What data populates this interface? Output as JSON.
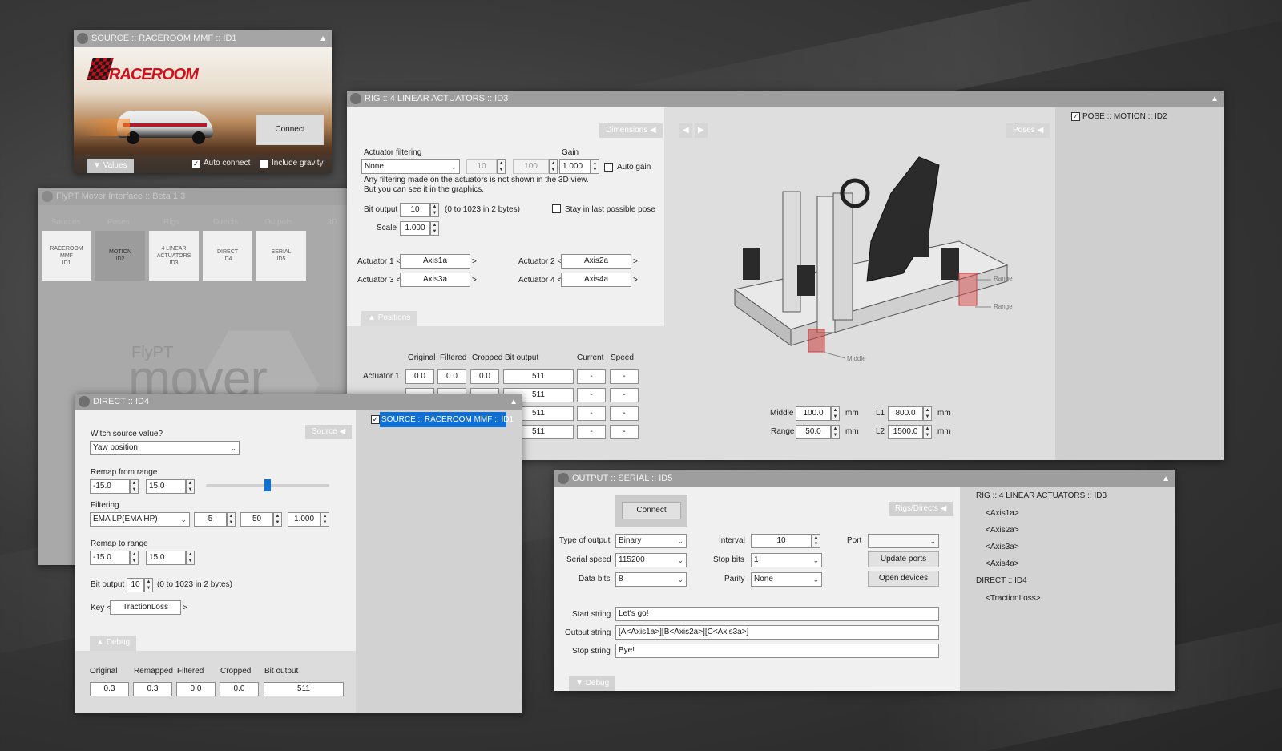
{
  "source_win": {
    "title": "SOURCE :: RACEROOM MMF :: ID1",
    "logo_text": "RACEROOM",
    "connect": "Connect",
    "values_tab": "Values",
    "auto_connect": "Auto connect",
    "include_gravity": "Include gravity"
  },
  "main_win": {
    "title": "FlyPT Mover Interface :: Beta 1.3",
    "headers": [
      "Sources",
      "Poses",
      "Rigs",
      "Directs",
      "Outputs",
      "3D"
    ],
    "tiles": [
      [
        "RACEROOM",
        "MMF",
        "ID1"
      ],
      [
        "MOTION",
        "ID2"
      ],
      [
        "4 LINEAR",
        "ACTUATORS",
        "ID3"
      ],
      [
        "DIRECT",
        "ID4"
      ],
      [
        "SERIAL",
        "ID5"
      ]
    ],
    "brand_small": "FlyPT",
    "brand_big": "mover"
  },
  "rig_win": {
    "title": "RIG :: 4 LINEAR ACTUATORS :: ID3",
    "dimensions_tab": "Dimensions",
    "poses_tab": "Poses",
    "actuator_filtering_label": "Actuator filtering",
    "filter_value": "None",
    "filter_p1": "10",
    "filter_p2": "100",
    "gain_label": "Gain",
    "gain": "1.000",
    "auto_gain": "Auto gain",
    "note1": "Any filtering made on the actuators is not shown in the 3D view.",
    "note2": "But you can see it in the graphics.",
    "bit_output_label": "Bit output",
    "bit_output": "10",
    "bit_range": "(0 to 1023 in 2 bytes)",
    "stay_last": "Stay in last possible pose",
    "scale_label": "Scale",
    "scale": "1.000",
    "act1_label": "Actuator 1 <",
    "act1": "Axis1a",
    "act2_label": "Actuator 2 <",
    "act2": "Axis2a",
    "act3_label": "Actuator 3 <",
    "act3": "Axis3a",
    "act4_label": "Actuator 4 <",
    "act4": "Axis4a",
    "gt": ">",
    "positions_tab": "Positions",
    "pos_headers": [
      "Original",
      "Filtered",
      "Cropped",
      "Bit output",
      "Current",
      "Speed"
    ],
    "pos_rows": [
      {
        "label": "Actuator 1",
        "original": "0.0",
        "filtered": "0.0",
        "cropped": "0.0",
        "bit": "511",
        "current": "-",
        "speed": "-"
      },
      {
        "label": "",
        "original": "",
        "filtered": "",
        "cropped": "",
        "bit": "511",
        "current": "-",
        "speed": "-"
      },
      {
        "label": "",
        "original": "",
        "filtered": "",
        "cropped": "",
        "bit": "511",
        "current": "-",
        "speed": "-"
      },
      {
        "label": "",
        "original": "",
        "filtered": "",
        "cropped": "",
        "bit": "511",
        "current": "-",
        "speed": "-"
      }
    ],
    "range_label1": "Range",
    "range_label2": "Range",
    "middle_callout": "Middle",
    "middle_label": "Middle",
    "middle": "100.0",
    "range_label": "Range",
    "range": "50.0",
    "l1_label": "L1",
    "l1": "800.0",
    "l2_label": "L2",
    "l2": "1500.0",
    "unit": "mm",
    "pose_checkbox": "POSE :: MOTION :: ID2"
  },
  "direct_win": {
    "title": "DIRECT :: ID4",
    "source_tab": "Source",
    "witch_label": "Witch source value?",
    "witch_value": "Yaw position",
    "remap_from_label": "Remap from range",
    "from_min": "-15.0",
    "from_max": "15.0",
    "slider_value": 0.5,
    "filtering_label": "Filtering",
    "filter_value": "EMA LP(EMA HP)",
    "f1": "5",
    "f2": "50",
    "f3": "1.000",
    "remap_to_label": "Remap to range",
    "to_min": "-15.0",
    "to_max": "15.0",
    "bit_output_label": "Bit output",
    "bit_output": "10",
    "bit_range": "(0 to 1023 in 2 bytes)",
    "key_label": "Key <",
    "key": "TractionLoss",
    "gt": ">",
    "debug_tab": "Debug",
    "debug_headers": [
      "Original",
      "Remapped",
      "Filtered",
      "Cropped",
      "Bit output"
    ],
    "debug_values": [
      "0.3",
      "0.3",
      "0.0",
      "0.0",
      "511"
    ],
    "source_selected": "SOURCE :: RACEROOM MMF :: ID1"
  },
  "output_win": {
    "title": "OUTPUT :: SERIAL :: ID5",
    "connect": "Connect",
    "rigs_tab": "Rigs/Directs",
    "type_label": "Type of output",
    "type": "Binary",
    "interval_label": "Interval",
    "interval": "10",
    "port_label": "Port",
    "port": "",
    "speed_label": "Serial speed",
    "speed": "115200",
    "stopbits_label": "Stop bits",
    "stopbits": "1",
    "update_ports": "Update ports",
    "databits_label": "Data bits",
    "databits": "8",
    "parity_label": "Parity",
    "parity": "None",
    "open_devices": "Open devices",
    "start_label": "Start string",
    "start": "Let's go!",
    "output_label": "Output string",
    "output": "[A<Axis1a>][B<Axis2a>][C<Axis3a>]",
    "stop_label": "Stop string",
    "stop": "Bye!",
    "debug_tab": "Debug",
    "side_list": [
      "RIG :: 4 LINEAR ACTUATORS :: ID3",
      "<Axis1a>",
      "<Axis2a>",
      "<Axis3a>",
      "<Axis4a>",
      "DIRECT :: ID4",
      "<TractionLoss>"
    ]
  }
}
